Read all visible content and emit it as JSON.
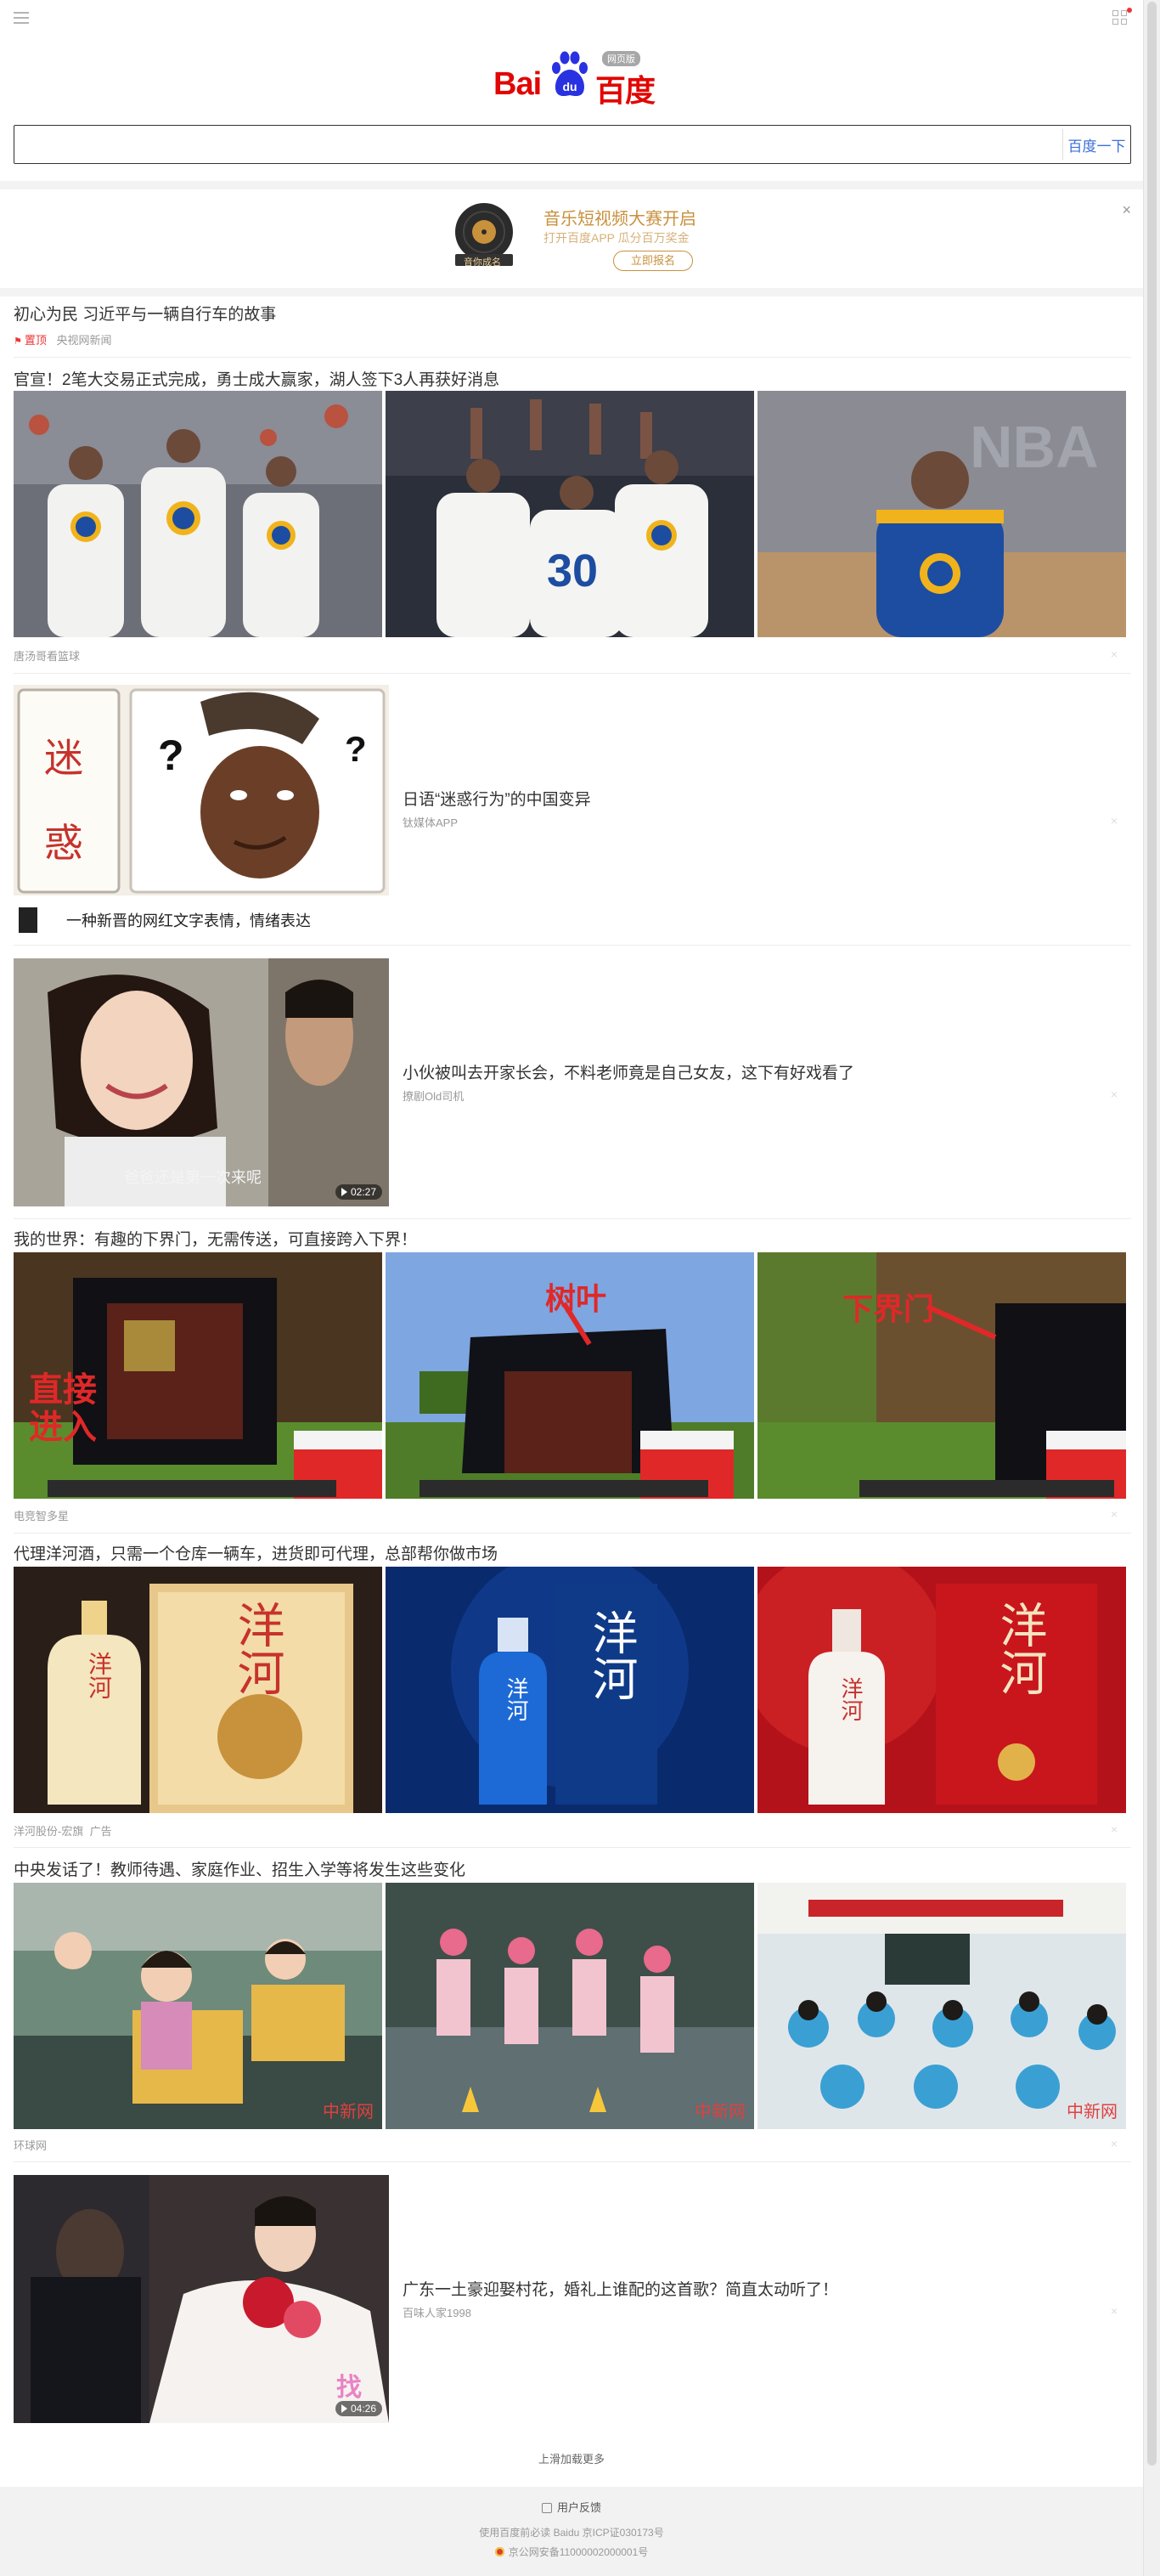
{
  "header": {
    "menu_icon": "hamburger-menu-icon",
    "apps_icon": "apps-grid-icon",
    "logo_text_left": "Bai",
    "logo_text_right": "百度",
    "logo_badge": "网页版"
  },
  "search": {
    "value": "",
    "placeholder": "",
    "button_label": "百度一下"
  },
  "banner": {
    "tag": "音你成名",
    "title": "音乐短视频大赛开启",
    "subtitle": "打开百度APP 瓜分百万奖金",
    "button": "立即报名",
    "close": "×"
  },
  "feed": {
    "top_news": {
      "title": "初心为民 习近平与一辆自行车的故事",
      "pin_label": "置顶",
      "source": "央视网新闻"
    },
    "items": [
      {
        "title": "官宣！2笔大交易正式完成，勇士成大赢家，湖人签下3人再获好消息",
        "source": "唐汤哥看篮球",
        "images": [
          "basketball-team-photo",
          "basketball-celebration-photo",
          "basketball-player-photo"
        ]
      },
      {
        "title": "日语“迷惑行为”的中国变异",
        "source": "钛媒体APP",
        "image_caption": "一种新晋的网红文字表情，情绪表达",
        "image_chars": [
          "迷",
          "惑"
        ]
      },
      {
        "title": "小伙被叫去开家长会，不料老师竟是自己女友，这下有好戏看了",
        "source": "撩剧Old司机",
        "duration": "02:27",
        "image_caption": "爸爸还是第一次来呢"
      },
      {
        "title": "我的世界：有趣的下界门，无需传送，可直接跨入下界！",
        "source": "电竞智多星",
        "image_labels": [
          "直接进入",
          "树叶",
          "下界门"
        ]
      },
      {
        "title": "代理洋河酒，只需一个仓库一辆车，进货即可代理，总部帮你做市场",
        "source": "洋河股份-宏旗",
        "ad_label": "广告",
        "product_chars": [
          "洋",
          "河"
        ]
      },
      {
        "title": "中央发话了！教师待遇、家庭作业、招生入学等将发生这些变化",
        "source": "环球网",
        "watermark": "中新网"
      },
      {
        "title": "广东一土豪迎娶村花，婚礼上谁配的这首歌？简直太动听了！",
        "source": "百味人家1998",
        "duration": "04:26"
      }
    ],
    "load_more": "上滑加载更多"
  },
  "footer": {
    "feedback": "用户反馈",
    "license": "使用百度前必读 Baidu 京ICP证030173号",
    "police": "京公网安备11000002000001号"
  },
  "colors": {
    "brand_red": "#e10601",
    "brand_blue": "#2932e1",
    "link_blue": "#3c6fd8",
    "banner_gold": "#c8913c"
  }
}
